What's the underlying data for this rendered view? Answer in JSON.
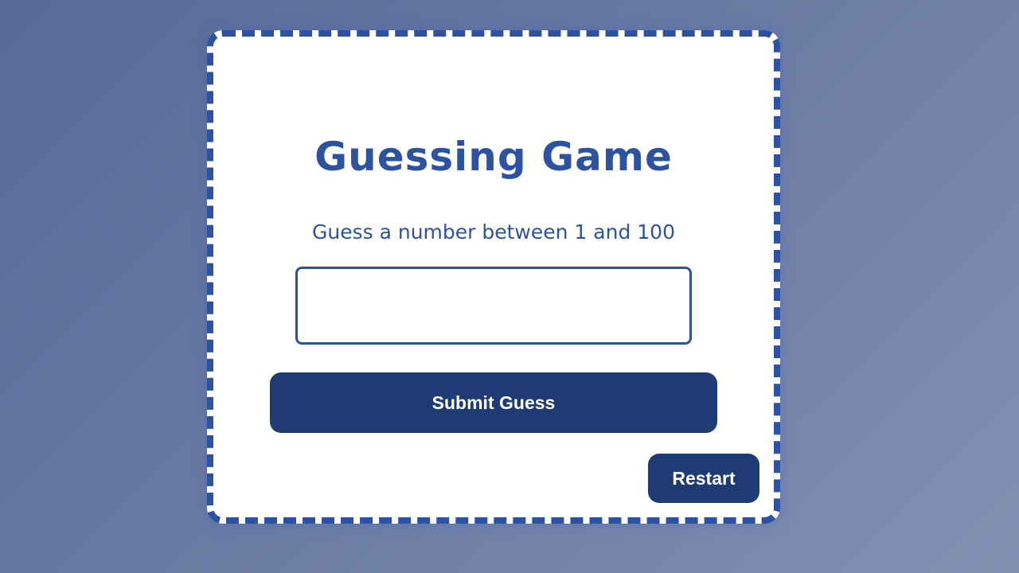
{
  "game": {
    "title": "Guessing Game",
    "instruction": "Guess a number between 1 and 100",
    "guess_value": "",
    "guess_placeholder": "",
    "submit_label": "Submit Guess",
    "restart_label": "Restart"
  },
  "colors": {
    "accent": "#2c52a0",
    "button": "#1f3b73",
    "card": "#ffffff"
  }
}
